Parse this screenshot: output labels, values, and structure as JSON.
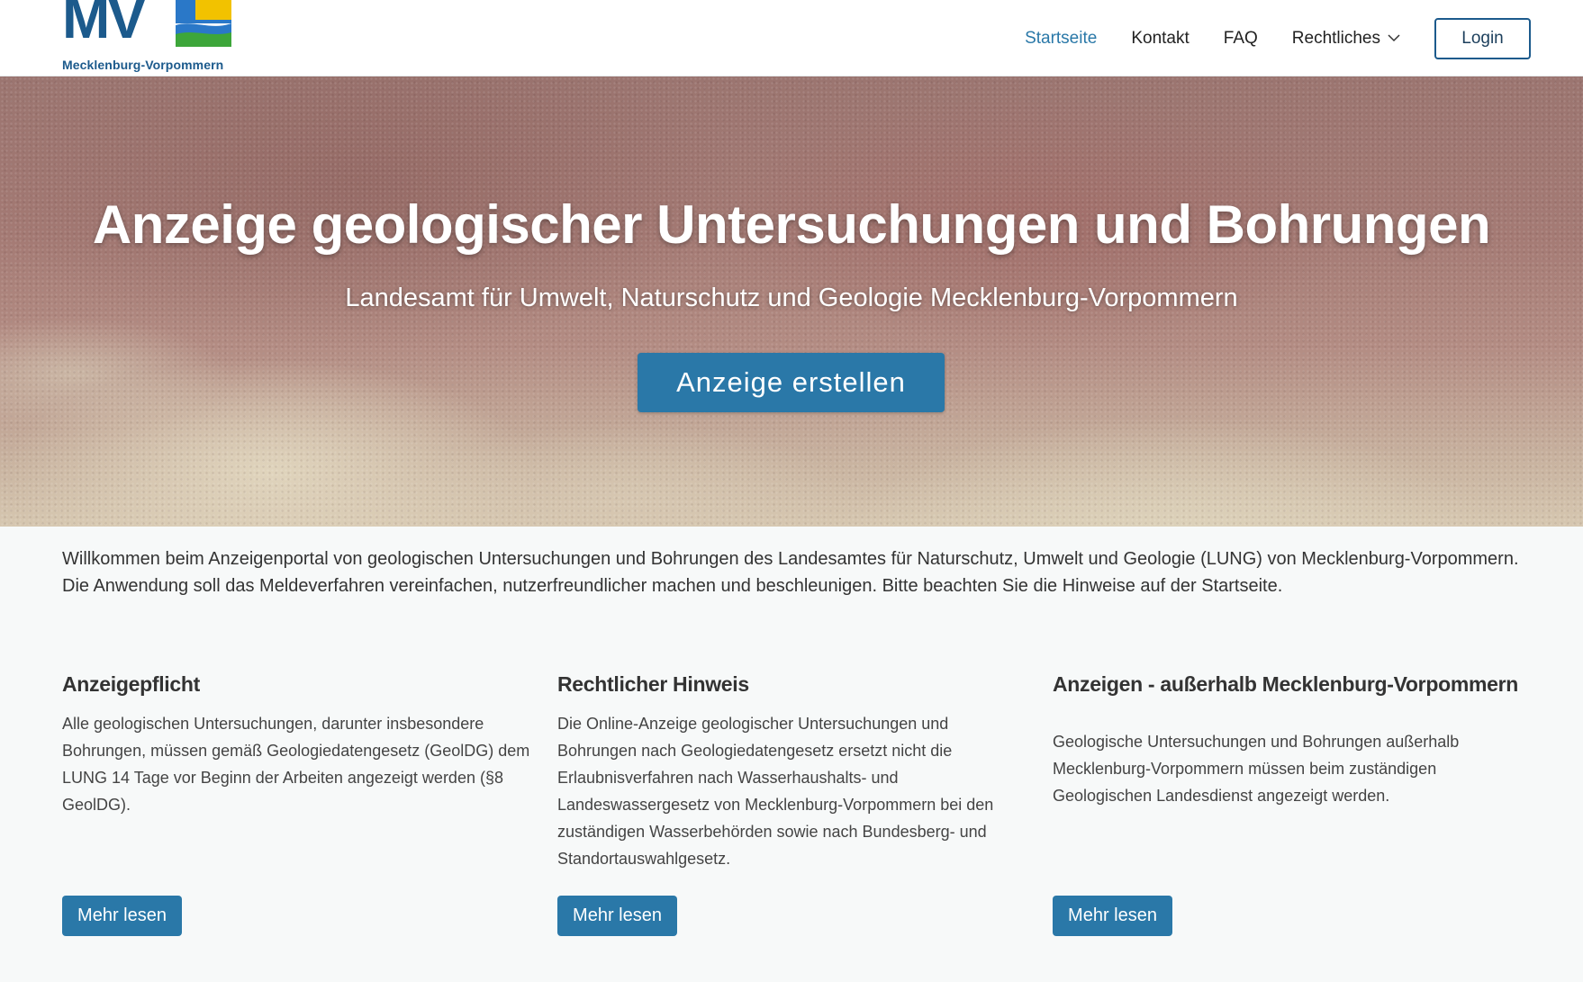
{
  "header": {
    "logo": {
      "mark": "MV",
      "subtitle": "Mecklenburg-Vorpommern"
    },
    "nav": [
      {
        "label": "Startseite",
        "active": true
      },
      {
        "label": "Kontakt"
      },
      {
        "label": "FAQ"
      },
      {
        "label": "Rechtliches",
        "has_dropdown": true
      }
    ],
    "login_label": "Login"
  },
  "hero": {
    "title": "Anzeige geologischer Untersuchungen und Bohrungen",
    "subtitle": "Landesamt für Umwelt, Naturschutz und Geologie Mecklenburg-Vorpommern",
    "button_label": "Anzeige erstellen"
  },
  "intro": "Willkommen beim Anzeigenportal von geologischen Untersuchungen und Bohrungen des Landesamtes für Naturschutz, Umwelt und Geologie (LUNG) von Mecklenburg-Vorpommern. Die Anwendung soll das Meldeverfahren vereinfachen, nutzerfreundlicher machen und beschleunigen. Bitte beachten Sie die Hinweise auf der Startseite.",
  "columns": [
    {
      "title": "Anzeigepflicht",
      "text": "Alle geologischen Untersuchungen, darunter insbesondere Bohrungen, müssen gemäß Geologiedatengesetz (GeolDG) dem LUNG 14 Tage vor Beginn der Arbeiten angezeigt werden (§8 GeolDG).",
      "button_label": "Mehr lesen"
    },
    {
      "title": "Rechtlicher Hinweis",
      "text": "Die Online-Anzeige geologischer Untersuchungen und Bohrungen nach Geologiedatengesetz ersetzt nicht die Erlaubnisverfahren nach Wasserhaushalts- und Landeswassergesetz von Mecklenburg-Vorpommern bei den zuständigen Wasserbehörden sowie nach Bundesberg- und Standortauswahlgesetz.",
      "button_label": "Mehr lesen"
    },
    {
      "title": "Anzeigen - außerhalb Mecklenburg-Vorpommern",
      "text": "Geologische Untersuchungen und Bohrungen außerhalb Mecklenburg-Vorpommern müssen beim zuständigen Geologischen Landesdienst angezeigt werden.",
      "button_label": "Mehr lesen"
    }
  ],
  "colors": {
    "primary": "#2a78a8",
    "brand_navy": "#1c5a8c",
    "page_bg": "#f7f9f9"
  }
}
